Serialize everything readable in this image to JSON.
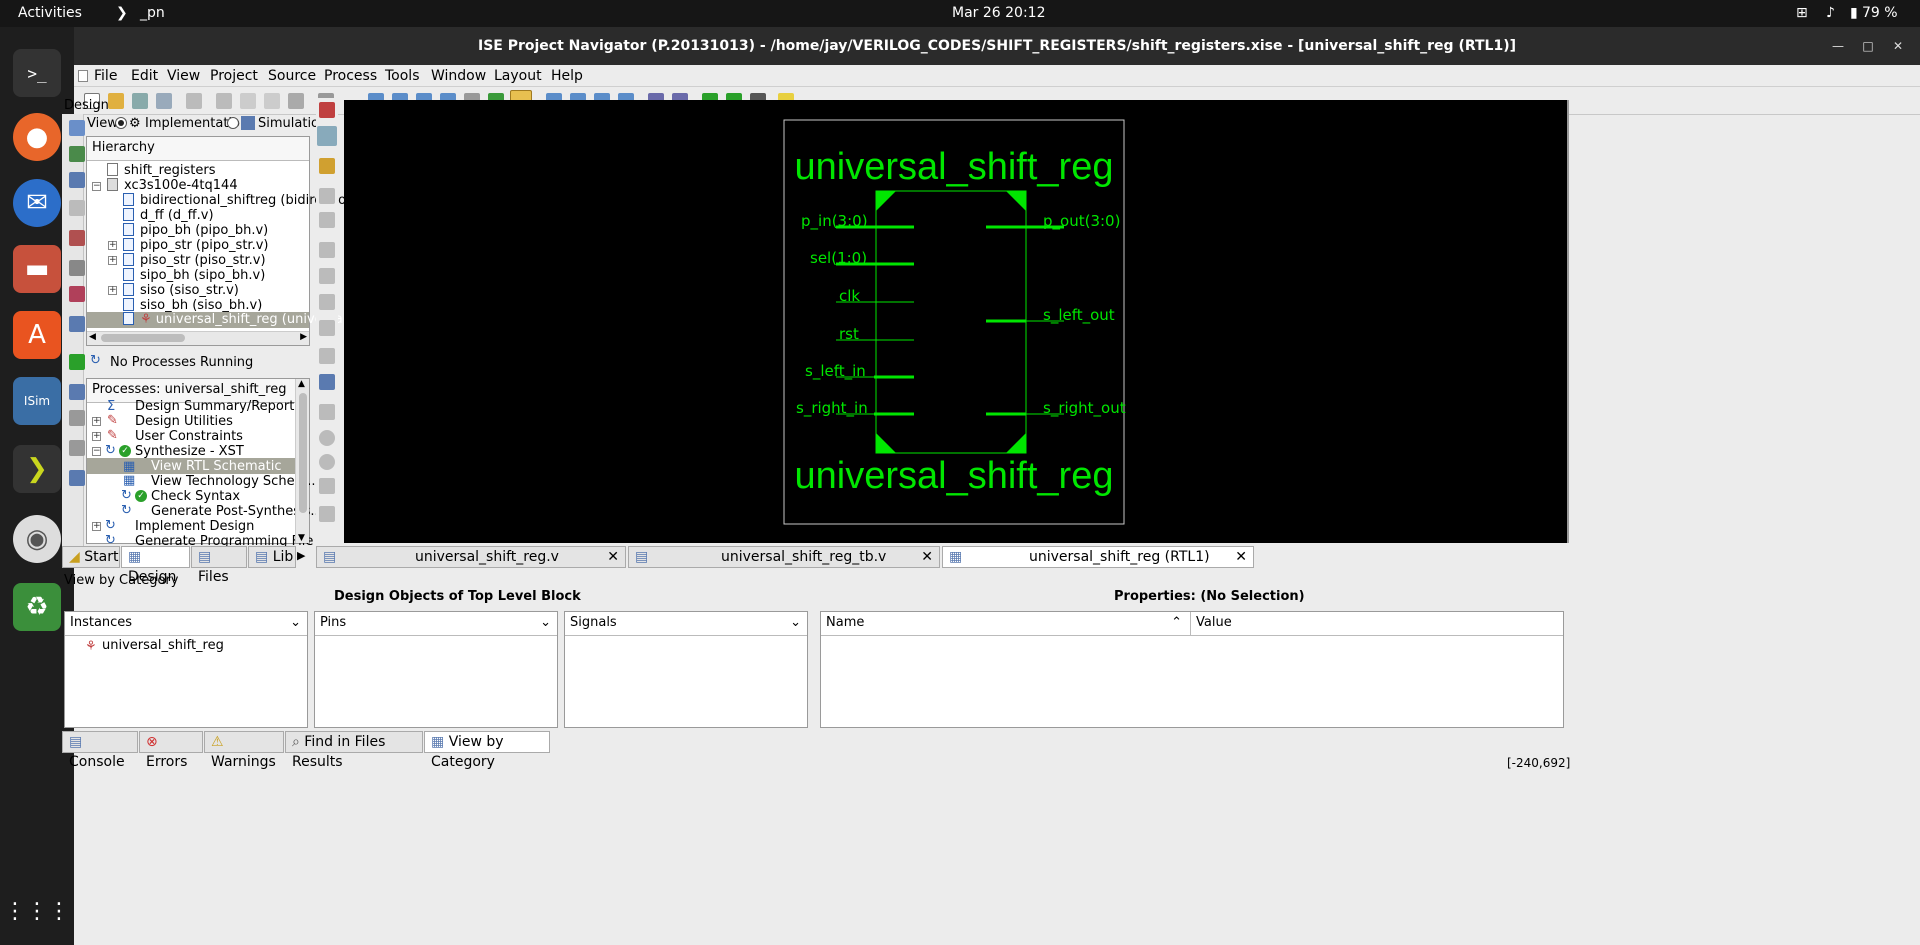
{
  "topbar": {
    "activities": "Activities",
    "app_name": "_pn",
    "datetime": "Mar 26  20:12",
    "battery": "79 %"
  },
  "window": {
    "title": "ISE Project Navigator (P.20131013) - /home/jay/VERILOG_CODES/SHIFT_REGISTERS/shift_registers.xise - [universal_shift_reg (RTL1)]"
  },
  "menu": [
    "File",
    "Edit",
    "View",
    "Project",
    "Source",
    "Process",
    "Tools",
    "Window",
    "Layout",
    "Help"
  ],
  "design": {
    "title": "Design",
    "view_label": "View",
    "implementation": "Implementatio",
    "simulation": "Simulatio",
    "hierarchy_header": "Hierarchy",
    "items": [
      "shift_registers",
      "xc3s100e-4tq144",
      "bidirectional_shiftreg (bidirectio",
      "d_ff (d_ff.v)",
      "pipo_bh (pipo_bh.v)",
      "pipo_str (pipo_str.v)",
      "piso_str (piso_str.v)",
      "sipo_bh (sipo_bh.v)",
      "siso (siso_str.v)",
      "siso_bh (siso_bh.v)",
      "universal_shift_reg (universal"
    ],
    "no_processes": "No Processes Running",
    "processes_header": "Processes: universal_shift_reg",
    "processes": [
      "Design Summary/Reports",
      "Design Utilities",
      "User Constraints",
      "Synthesize - XST",
      "View RTL Schematic",
      "View Technology Schem...",
      "Check Syntax",
      "Generate Post-Synthesis...",
      "Implement Design",
      "Generate Programming File"
    ],
    "tabs": [
      "Start",
      "Design",
      "Files",
      "Lib"
    ]
  },
  "schematic": {
    "block_name_top": "universal_shift_reg",
    "block_name_bottom": "universal_shift_reg",
    "inputs": [
      "p_in(3:0)",
      "sel(1:0)",
      "clk",
      "rst",
      "s_left_in",
      "s_right_in"
    ],
    "outputs": [
      "p_out(3:0)",
      "s_left_out",
      "s_right_out"
    ],
    "color": "#00e600"
  },
  "doc_tabs": [
    "universal_shift_reg.v",
    "universal_shift_reg_tb.v",
    "universal_shift_reg (RTL1)"
  ],
  "bottom": {
    "title": "View by Category",
    "design_objects_header": "Design Objects of Top Level Block",
    "properties_header": "Properties: (No Selection)",
    "instances_label": "Instances",
    "pins_label": "Pins",
    "signals_label": "Signals",
    "name_label": "Name",
    "value_label": "Value",
    "instance_item": "universal_shift_reg"
  },
  "console_tabs": [
    "Console",
    "Errors",
    "Warnings",
    "Find in Files Results",
    "View by Category"
  ],
  "status_coords": "[-240,692]"
}
